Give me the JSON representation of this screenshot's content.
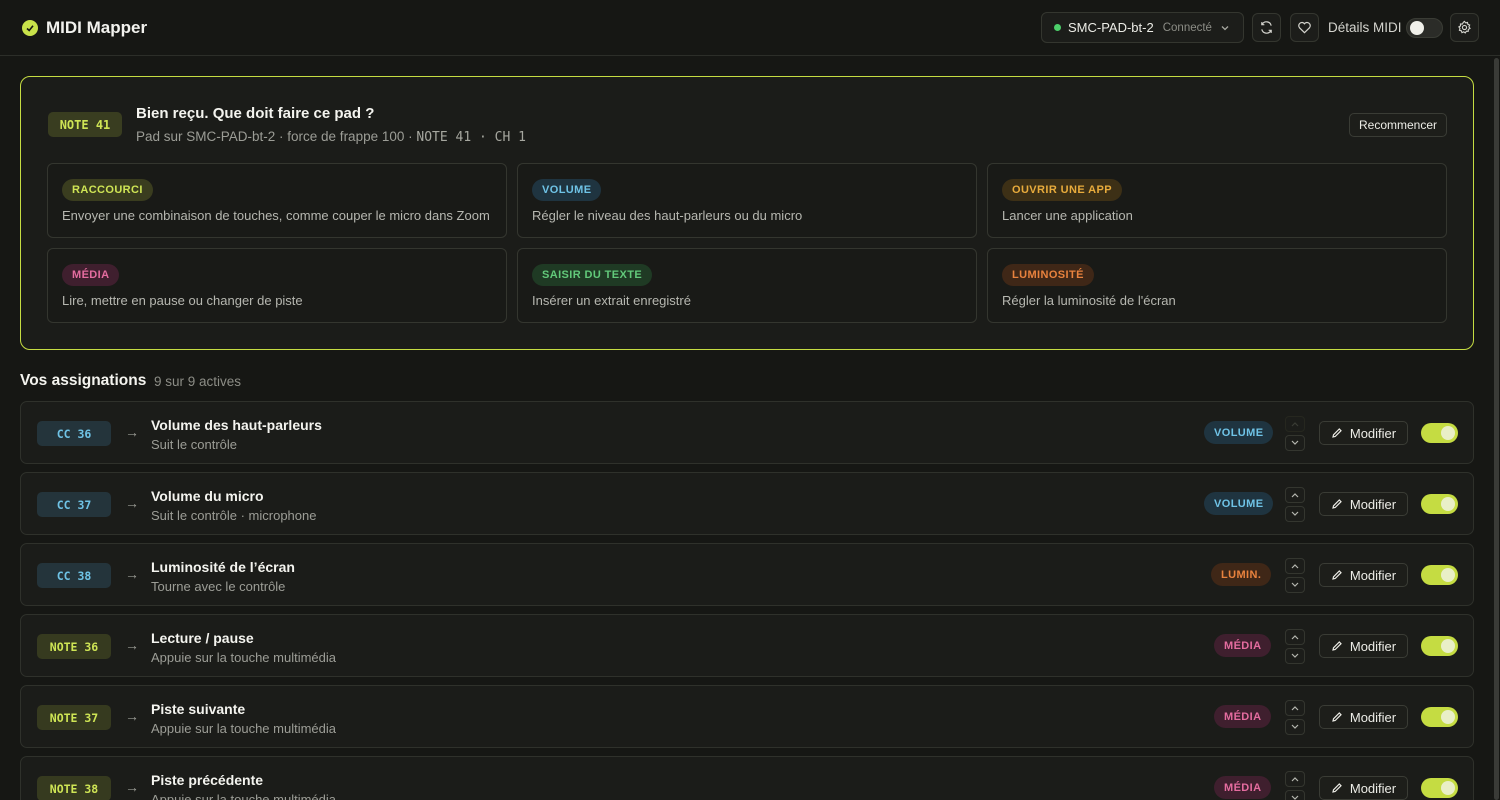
{
  "app": {
    "title": "MIDI Mapper"
  },
  "header": {
    "device_name": "SMC-PAD-bt-2",
    "device_status": "Connecté",
    "midi_details_label": "Détails MIDI",
    "midi_details_on": false
  },
  "prompt": {
    "badge": "NOTE 41",
    "title": "Bien reçu. Que doit faire ce pad ?",
    "subtitle_text": "Pad sur SMC-PAD-bt-2 · force de frappe 100 ·",
    "subtitle_mono": "NOTE 41 · CH 1",
    "restart_label": "Recommencer",
    "options": [
      {
        "tag": "RACCOURCI",
        "desc": "Envoyer une combinaison de touches, comme couper le micro dans Zoom",
        "color": "#cfe555"
      },
      {
        "tag": "VOLUME",
        "desc": "Régler le niveau des haut-parleurs ou du micro",
        "color": "#6fc3e6"
      },
      {
        "tag": "OUVRIR UNE APP",
        "desc": "Lancer une application",
        "color": "#e8ab3c"
      },
      {
        "tag": "MÉDIA",
        "desc": "Lire, mettre en pause ou changer de piste",
        "color": "#e46c9f"
      },
      {
        "tag": "SAISIR DU TEXTE",
        "desc": "Insérer un extrait enregistré",
        "color": "#62c97a"
      },
      {
        "tag": "LUMINOSITÉ",
        "desc": "Régler la luminosité de l'écran",
        "color": "#e8823e"
      }
    ]
  },
  "assignments": {
    "title": "Vos assignations",
    "count": "9 sur 9 actives",
    "edit_label": "Modifier",
    "arrow": "→",
    "rows": [
      {
        "trigger": "CC 36",
        "title": "Volume des haut-parleurs",
        "sub": "Suit le contrôle",
        "tag": "VOLUME",
        "enabled": true
      },
      {
        "trigger": "CC 37",
        "title": "Volume du micro",
        "sub": "Suit le contrôle · microphone",
        "tag": "VOLUME",
        "enabled": true
      },
      {
        "trigger": "CC 38",
        "title": "Luminosité de l’écran",
        "sub": "Tourne avec le contrôle",
        "tag": "LUMIN.",
        "enabled": true
      },
      {
        "trigger": "NOTE 36",
        "title": "Lecture / pause",
        "sub": "Appuie sur la touche multimédia",
        "tag": "MÉDIA",
        "enabled": true
      },
      {
        "trigger": "NOTE 37",
        "title": "Piste suivante",
        "sub": "Appuie sur la touche multimédia",
        "tag": "MÉDIA",
        "enabled": true
      },
      {
        "trigger": "NOTE 38",
        "title": "Piste précédente",
        "sub": "Appuie sur la touche multimédia",
        "tag": "MÉDIA",
        "enabled": true
      }
    ]
  },
  "colors": {
    "accent": "#c5dc42",
    "connected": "#4ccf6a",
    "volume": "#6fc3e6",
    "media": "#e46c9f",
    "brightness": "#e8823e"
  }
}
